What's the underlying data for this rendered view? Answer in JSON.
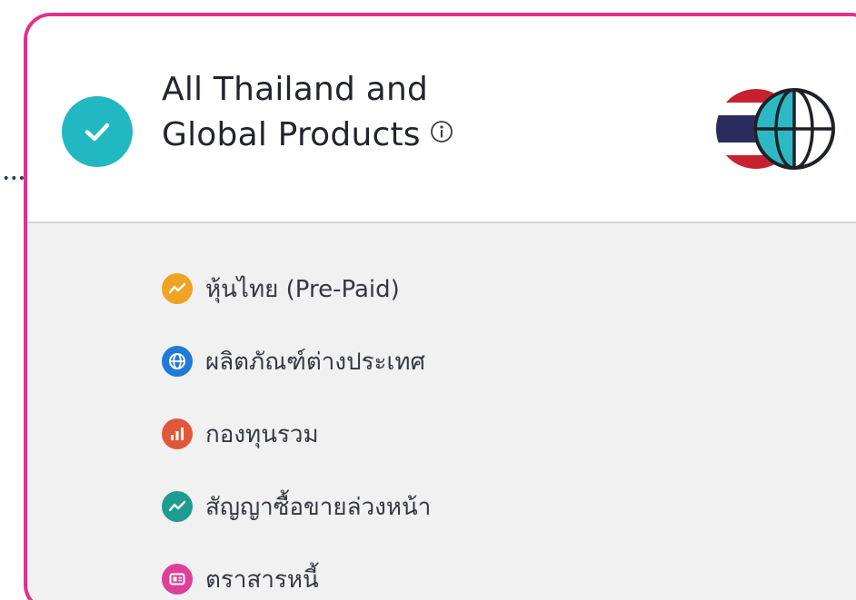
{
  "card": {
    "selected": true,
    "title_line1": "All Thailand and",
    "title_line2": "Global Products",
    "info_icon": "info-circle-icon",
    "emblem": "thai-flag-globe-icon"
  },
  "products": [
    {
      "label": "หุ้นไทย (Pre-Paid)",
      "icon": "trend-line-icon",
      "color": "#f0a224"
    },
    {
      "label": "ผลิตภัณฑ์ต่างประเทศ",
      "icon": "globe-icon",
      "color": "#1f7ad8"
    },
    {
      "label": "กองทุนรวม",
      "icon": "bar-chart-icon",
      "color": "#e0583a"
    },
    {
      "label": "สัญญาซื้อขายล่วงหน้า",
      "icon": "trend-line-icon",
      "color": "#1d9c8f"
    },
    {
      "label": "ตราสารหนี้",
      "icon": "bond-certificate-icon",
      "color": "#de3f97"
    }
  ],
  "colors": {
    "border": "#e0318c",
    "check": "#22b8c2",
    "header_bg": "#ffffff",
    "body_bg": "#f1f1f2"
  }
}
